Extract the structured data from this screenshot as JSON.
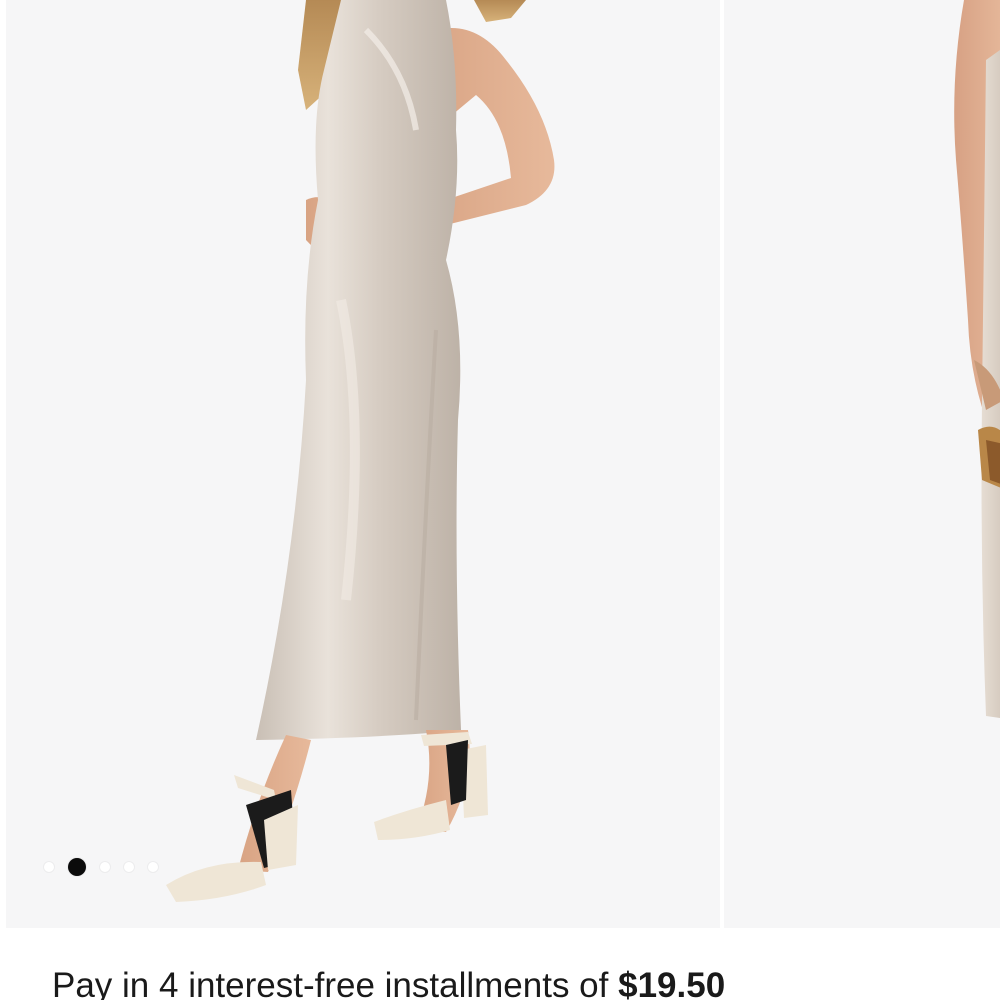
{
  "product": {
    "installments_text": "Pay in 4 interest-free installments of",
    "installment_amount": "$19.50"
  },
  "carousel": {
    "slide_count": 5,
    "active_index": 1,
    "main_image": "model-in-champagne-satin-halter-maxi-dress-image",
    "next_image": "next-product-image-preview"
  },
  "colors": {
    "dress": "#d8cfc6",
    "background": "#f6f6f7",
    "active_dot": "#0b0b0b"
  }
}
